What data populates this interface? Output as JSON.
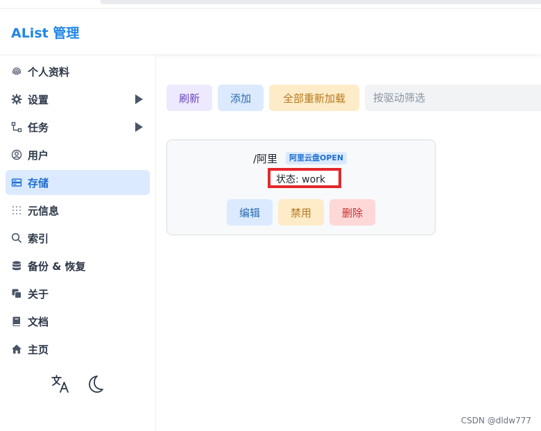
{
  "header": {
    "title": "AList 管理"
  },
  "sidebar": {
    "items": [
      {
        "label": "个人资料",
        "icon": "fingerprint-icon"
      },
      {
        "label": "设置",
        "icon": "gear-icon",
        "expandable": true
      },
      {
        "label": "任务",
        "icon": "tasks-icon",
        "expandable": true
      },
      {
        "label": "用户",
        "icon": "user-circle-icon"
      },
      {
        "label": "存储",
        "icon": "storage-icon",
        "active": true
      },
      {
        "label": "元信息",
        "icon": "metadata-icon"
      },
      {
        "label": "索引",
        "icon": "search-icon"
      },
      {
        "label": "备份 & 恢复",
        "icon": "database-icon"
      },
      {
        "label": "关于",
        "icon": "copy-icon"
      },
      {
        "label": "文档",
        "icon": "book-icon"
      },
      {
        "label": "主页",
        "icon": "home-icon"
      }
    ],
    "bottom": {
      "language_icon": "translate-icon",
      "theme_icon": "moon-icon"
    }
  },
  "toolbar": {
    "refresh_label": "刷新",
    "add_label": "添加",
    "reload_all_label": "全部重新加载",
    "filter_placeholder": "按驱动筛选"
  },
  "storage_card": {
    "mount_path": "/阿里",
    "driver_badge": "阿里云盘OPEN",
    "status": "状态: work",
    "edit_label": "编辑",
    "disable_label": "禁用",
    "delete_label": "删除"
  },
  "watermark": "CSDN @dldw777",
  "colors": {
    "accent": "#1e86e6",
    "active_bg": "#dbeafe",
    "highlight_box": "#e5262b"
  }
}
